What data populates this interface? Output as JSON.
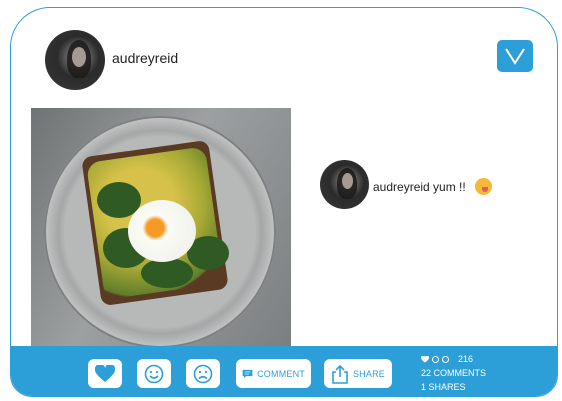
{
  "post": {
    "username": "audreyreid",
    "action_icon": "check-v-icon",
    "image_alt": "avocado toast with poached egg on a gray plate"
  },
  "comment": {
    "username": "audreyreid",
    "text": "yum !!",
    "emoji": "yum-emoji"
  },
  "actions": {
    "like_icon": "heart-icon",
    "happy_icon": "smile-icon",
    "sad_icon": "frown-icon",
    "comment_label": "COMMENT",
    "share_label": "SHARE"
  },
  "stats": {
    "reactions": "216",
    "comments": "22 COMMENTS",
    "shares": "1 SHARES"
  },
  "colors": {
    "accent": "#2d9fd8",
    "text": "#222222",
    "background": "#ffffff"
  }
}
